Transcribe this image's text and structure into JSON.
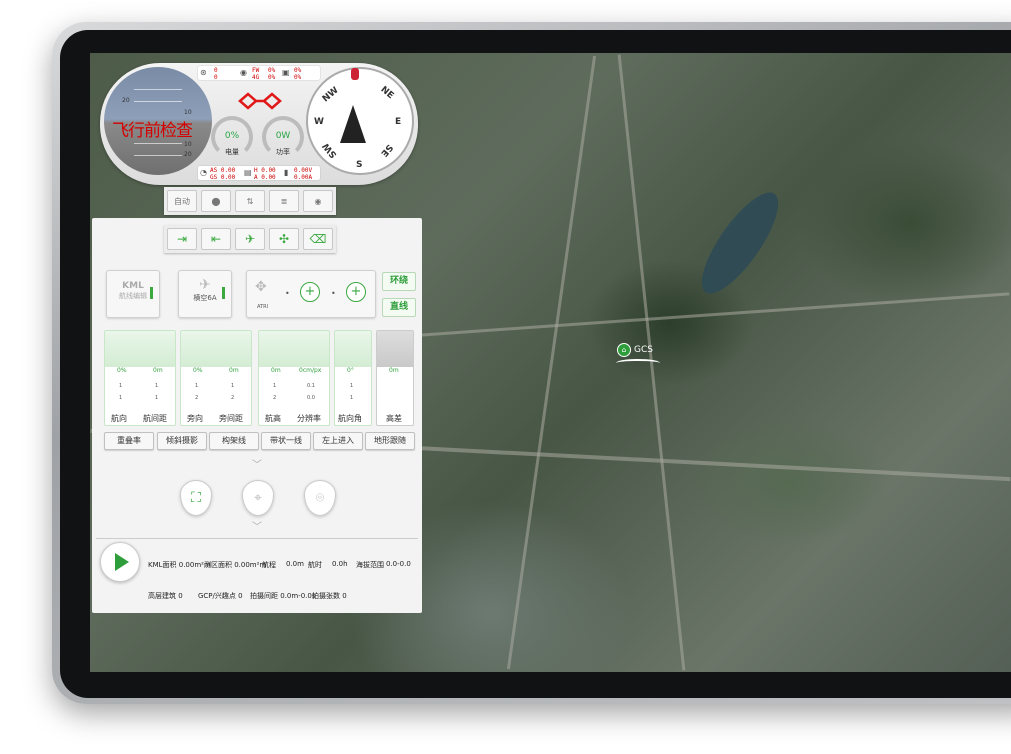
{
  "header": {
    "preflight_label": "飞行前检查",
    "attitude_scale": [
      "20",
      "10",
      "10",
      "20"
    ],
    "battery": {
      "value": "0%",
      "label": "电量"
    },
    "power": {
      "value": "0W",
      "label": "功率"
    },
    "status_top": {
      "sat_a": "0",
      "sat_b": "0",
      "fw": "FW",
      "fw_v": "0%",
      "g4": "4G",
      "g4_v": "0%",
      "rc_a": "0%",
      "rc_b": "0%"
    },
    "status_bottom": {
      "as": "AS 0.00",
      "gs": "GS 0.00",
      "h": "H 0.00",
      "a": "A 0.00",
      "v": "0.00V",
      "amp": "0.00A"
    },
    "compass": {
      "n": "N",
      "ne": "NE",
      "e": "E",
      "se": "SE",
      "s": "S",
      "sw": "SW",
      "w": "W",
      "nw": "NW"
    }
  },
  "toolbar1": {
    "auto": "自动"
  },
  "route": {
    "kml_title": "KML",
    "kml_sub": "航线编辑",
    "aircraft": "横空6A",
    "atri": "ATRI",
    "loop": "环绕",
    "straight": "直线"
  },
  "params": [
    {
      "v1": "0%",
      "v2": "0m",
      "r1a": "1",
      "r1b": "1",
      "r2a": "1",
      "r2b": "1",
      "l1": "航向",
      "l2": "航间距"
    },
    {
      "v1": "0%",
      "v2": "0m",
      "r1a": "1",
      "r1b": "1",
      "r2a": "2",
      "r2b": "2",
      "l1": "旁向",
      "l2": "旁间距"
    },
    {
      "v1": "0m",
      "v2": "0cm/px",
      "r1a": "1",
      "r1b": "0.1",
      "r2a": "2",
      "r2b": "0.0",
      "l1": "航高",
      "l2": "分辨率"
    },
    {
      "v1": "0°",
      "r1a": "1",
      "r2a": "1",
      "l1": "航向角"
    },
    {
      "v1": "0m",
      "l1": "高差"
    }
  ],
  "tools": [
    "重叠率",
    "倾斜摄影",
    "构架线",
    "带状一线",
    "左上进入",
    "地形跟随"
  ],
  "summary": {
    "kml_area": "KML面积 0.00m²m",
    "survey_area": "测区面积 0.00m²m",
    "range_l": "航程",
    "range_v": "0.0m",
    "time_l": "航时",
    "time_v": "0.0h",
    "alt_l": "海拔范围",
    "alt_v": "0.0-0.0",
    "tall": "高层建筑 0",
    "gcp": "GCP/兴趣点 0",
    "photo_dist": "拍摄间距 0.0m-0.0s",
    "photo_count": "拍摄张数 0"
  },
  "map": {
    "gcs_label": "GCS"
  }
}
